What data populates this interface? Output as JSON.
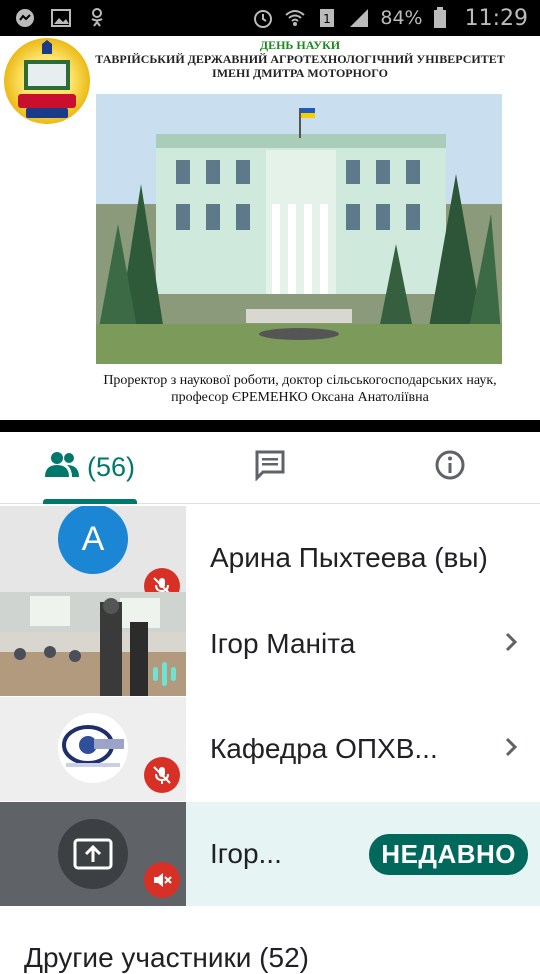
{
  "status_bar": {
    "battery": "84%",
    "time": "11:29"
  },
  "slide": {
    "title_line1": "ДЕНЬ НАУКИ",
    "title_line2": "ТАВРІЙСЬКИЙ ДЕРЖАВНИЙ АГРОТЕХНОЛОГІЧНИЙ УНІВЕРСИТЕТ",
    "title_line3": "ІМЕНІ ДМИТРА МОТОРНОГО",
    "caption_line1": "Проректор з наукової роботи, доктор сільськогосподарських наук,",
    "caption_line2": "професор ЄРЕМЕНКО Оксана Анатоліївна"
  },
  "tabs": {
    "people_count": "(56)"
  },
  "participants": [
    {
      "avatar_letter": "А",
      "name": "Арина Пыхтеева (вы)"
    },
    {
      "name": "Ігор Маніта"
    },
    {
      "name": "Кафедра ОПХВ..."
    },
    {
      "name": "Ігор...",
      "badge": "НЕДАВНО"
    }
  ],
  "others_section": {
    "label": "Другие участники (52)"
  },
  "colors": {
    "accent": "#00796b",
    "mic_off": "#d93025",
    "badge_bg": "#00695c",
    "highlight_row": "#e6f5f3"
  }
}
